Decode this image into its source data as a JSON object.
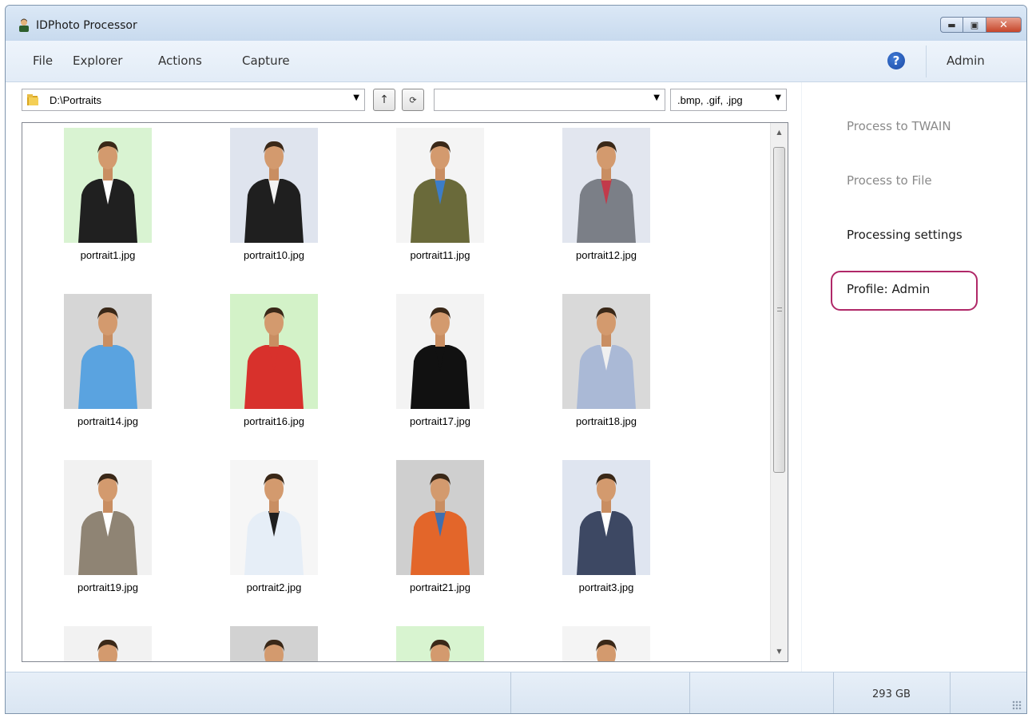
{
  "window": {
    "title": "IDPhoto Processor"
  },
  "menu": {
    "file": "File",
    "explorer": "Explorer",
    "actions": "Actions",
    "capture": "Capture",
    "admin": "Admin"
  },
  "toolbar": {
    "path": "D:\\Portraits",
    "search_value": "",
    "filter": ".bmp, .gif, .jpg"
  },
  "thumbnails": [
    {
      "label": "portrait1.jpg",
      "bg": "#d9f3d2",
      "shirt": "#202020",
      "inner": "#ffffff"
    },
    {
      "label": "portrait10.jpg",
      "bg": "#dfe4ee",
      "shirt": "#1f1f1f",
      "inner": "#f3f3f3"
    },
    {
      "label": "portrait11.jpg",
      "bg": "#f4f4f4",
      "shirt": "#6a6a3a",
      "inner": "#3c7dc8"
    },
    {
      "label": "portrait12.jpg",
      "bg": "#e2e6ef",
      "shirt": "#7b7f87",
      "inner": "#c23a4a"
    },
    {
      "label": "portrait14.jpg",
      "bg": "#d6d6d6",
      "shirt": "#5aa3e0",
      "inner": "#5aa3e0"
    },
    {
      "label": "portrait16.jpg",
      "bg": "#d3f2c8",
      "shirt": "#d8312c",
      "inner": "#d8312c"
    },
    {
      "label": "portrait17.jpg",
      "bg": "#f3f3f3",
      "shirt": "#111111",
      "inner": "#111111"
    },
    {
      "label": "portrait18.jpg",
      "bg": "#d9d9d9",
      "shirt": "#aab9d6",
      "inner": "#f0f0f0"
    },
    {
      "label": "portrait19.jpg",
      "bg": "#f1f1f1",
      "shirt": "#8f8474",
      "inner": "#ffffff"
    },
    {
      "label": "portrait2.jpg",
      "bg": "#f6f6f6",
      "shirt": "#e6eef7",
      "inner": "#1f1f1f"
    },
    {
      "label": "portrait21.jpg",
      "bg": "#cfcfcf",
      "shirt": "#e3662a",
      "inner": "#3f6fb0"
    },
    {
      "label": "portrait3.jpg",
      "bg": "#dfe5f0",
      "shirt": "#3d4863",
      "inner": "#ffffff"
    },
    {
      "label": "",
      "bg": "#f2f2f2",
      "shirt": "#333333",
      "inner": "#333333"
    },
    {
      "label": "",
      "bg": "#d2d2d2",
      "shirt": "#333333",
      "inner": "#333333"
    },
    {
      "label": "",
      "bg": "#d8f4d0",
      "shirt": "#333333",
      "inner": "#333333"
    },
    {
      "label": "",
      "bg": "#f4f4f4",
      "shirt": "#333333",
      "inner": "#333333"
    }
  ],
  "actions": {
    "process_twain": "Process to TWAIN",
    "process_file": "Process to File",
    "settings": "Processing settings",
    "profile": "Profile: Admin"
  },
  "status": {
    "disk": "293 GB"
  },
  "colors": {
    "accent": "#b02868",
    "window_frame": "#cfe0f2"
  }
}
